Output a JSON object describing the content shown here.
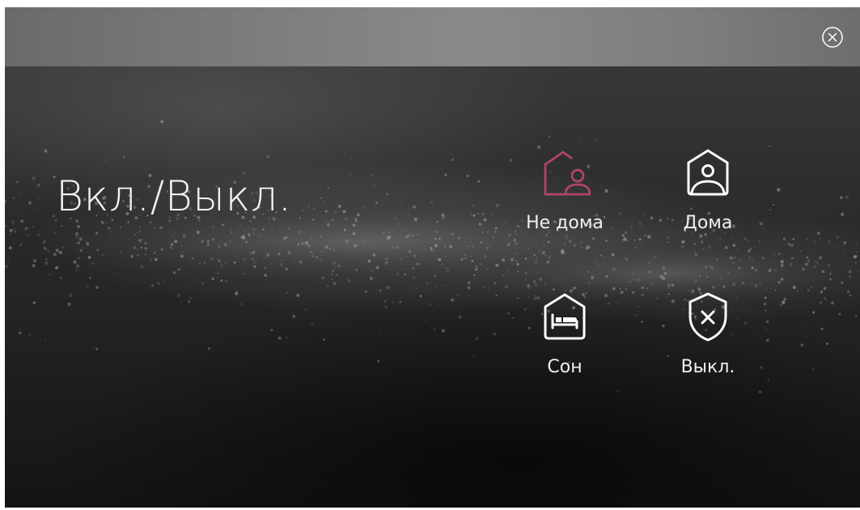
{
  "title": "Вкл./Выкл.",
  "accent_color": "#b0436f",
  "close_icon": "close-circle-icon",
  "modes": [
    {
      "label": "Не дома",
      "icon": "away-home-person-icon",
      "active": true
    },
    {
      "label": "Дома",
      "icon": "home-person-icon",
      "active": false
    },
    {
      "label": "Сон",
      "icon": "home-bed-icon",
      "active": false
    },
    {
      "label": "Выкл.",
      "icon": "shield-x-icon",
      "active": false
    }
  ]
}
